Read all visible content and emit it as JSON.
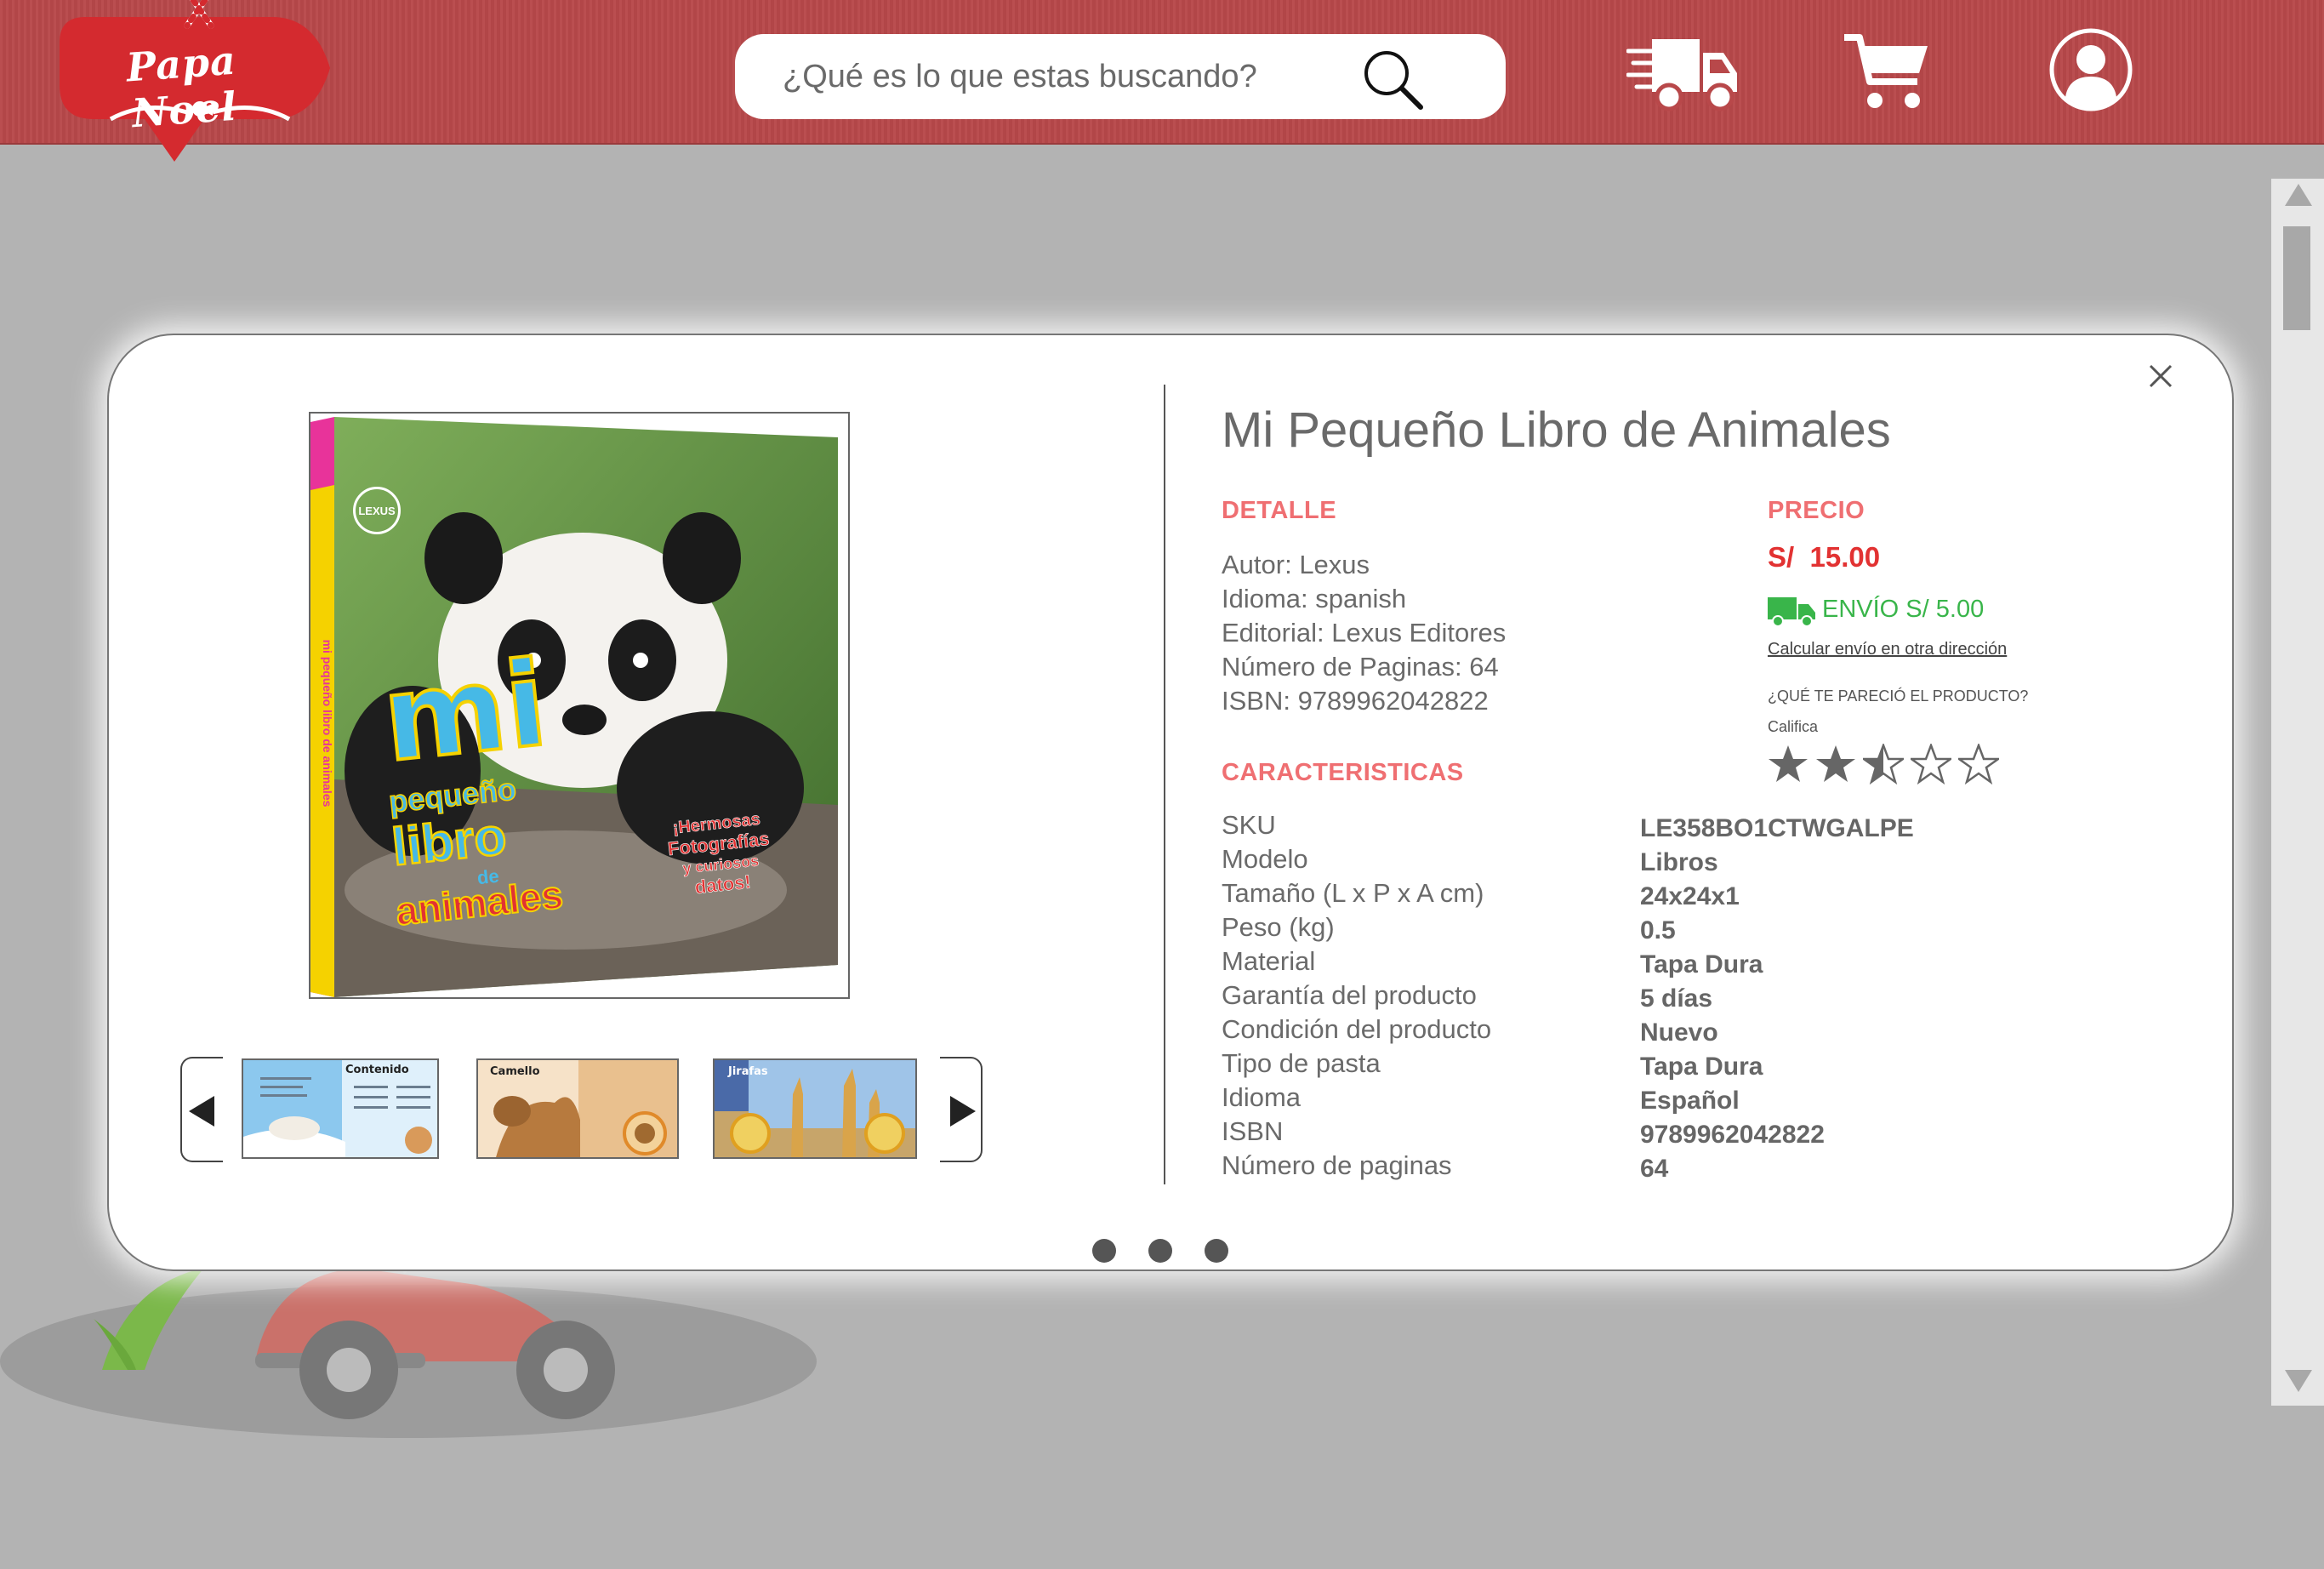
{
  "header": {
    "logo_text": "Papa Noel",
    "search_placeholder": "¿Qué es lo que estas buscando?",
    "icons": [
      "search-icon",
      "truck-icon",
      "cart-icon",
      "user-icon"
    ],
    "colors": {
      "bar": "#b8484a",
      "logo": "#d42a2f"
    }
  },
  "modal": {
    "title": "Mi Pequeño Libro de Animales",
    "cover": {
      "brand": "LEXUS",
      "title_lines": [
        "mi",
        "pequeño",
        "libro",
        "de",
        "animales"
      ],
      "tagline": [
        "¡Hermosas",
        "Fotografías",
        "y curiosos",
        "datos!"
      ],
      "spine": "mi pequeño libro de animales"
    },
    "thumbnails": [
      {
        "label": "Contenido"
      },
      {
        "label": "Camello"
      },
      {
        "label": "Jirafas"
      }
    ],
    "detail": {
      "label": "DETALLE",
      "items": [
        "Autor: Lexus",
        "Idioma: spanish",
        "Editorial: Lexus Editores",
        "Número de Paginas: 64",
        "ISBN: 9789962042822"
      ]
    },
    "price": {
      "label": "PRECIO",
      "value": "S/  15.00",
      "shipping": "ENVÍO S/ 5.00",
      "calc_link": "Calcular envío en otra dirección",
      "question": "¿QUÉ TE PARECIÓ EL PRODUCTO?",
      "rate_label": "Califica",
      "rating": 2.5,
      "rating_max": 5
    },
    "characteristics": {
      "label": "CARACTERISTICAS",
      "rows": [
        {
          "key": "SKU",
          "value": "LE358BO1CTWGALPE"
        },
        {
          "key": "Modelo",
          "value": "Libros"
        },
        {
          "key": "Tamaño (L x P x A cm)",
          "value": "24x24x1"
        },
        {
          "key": "Peso (kg)",
          "value": "0.5"
        },
        {
          "key": "Material",
          "value": "Tapa Dura"
        },
        {
          "key": "Garantía del producto",
          "value": "5 días"
        },
        {
          "key": "Condición del producto",
          "value": "Nuevo"
        },
        {
          "key": "Tipo de pasta",
          "value": "Tapa Dura"
        },
        {
          "key": "Idioma",
          "value": "Español"
        },
        {
          "key": "ISBN",
          "value": "9789962042822"
        },
        {
          "key": "Número de paginas",
          "value": "64"
        }
      ]
    },
    "pagination": {
      "pages": 3
    },
    "colors": {
      "accent": "#ef6f72",
      "price": "#e23232",
      "shipping": "#39b54a"
    }
  }
}
